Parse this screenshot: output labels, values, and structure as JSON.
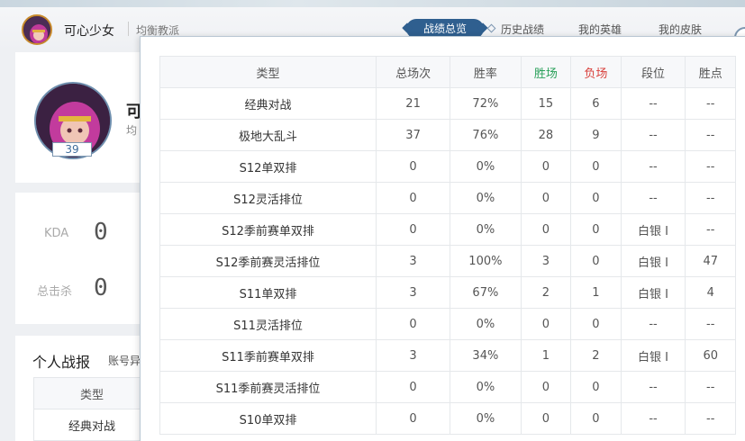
{
  "header": {
    "player_name": "可心少女",
    "school": "均衡教派",
    "tabs": [
      "战绩总览",
      "历史战绩",
      "我的英雄",
      "我的皮肤"
    ],
    "active_tab": "战绩总览"
  },
  "profile": {
    "name_peek": "可",
    "school_peek": "均",
    "level": "39"
  },
  "kda": {
    "kda_label": "KDA",
    "kda_value": "0",
    "kills_label": "总击杀",
    "kills_value": "0"
  },
  "personal_stats": {
    "title": "个人战报",
    "subtitle": "账号异",
    "mini_table": [
      [
        "类型"
      ],
      [
        "经典对战"
      ]
    ]
  },
  "modal": {
    "columns": [
      "类型",
      "总场次",
      "胜率",
      "胜场",
      "负场",
      "段位",
      "胜点"
    ],
    "colors": {
      "win": "#2aa05a",
      "lose": "#d9403c"
    },
    "rows": [
      [
        "经典对战",
        "21",
        "72%",
        "15",
        "6",
        "--",
        "--"
      ],
      [
        "极地大乱斗",
        "37",
        "76%",
        "28",
        "9",
        "--",
        "--"
      ],
      [
        "S12单双排",
        "0",
        "0%",
        "0",
        "0",
        "--",
        "--"
      ],
      [
        "S12灵活排位",
        "0",
        "0%",
        "0",
        "0",
        "--",
        "--"
      ],
      [
        "S12季前赛单双排",
        "0",
        "0%",
        "0",
        "0",
        "白银 Ⅰ",
        "--"
      ],
      [
        "S12季前赛灵活排位",
        "3",
        "100%",
        "3",
        "0",
        "白银 Ⅰ",
        "47"
      ],
      [
        "S11单双排",
        "3",
        "67%",
        "2",
        "1",
        "白银 Ⅰ",
        "4"
      ],
      [
        "S11灵活排位",
        "0",
        "0%",
        "0",
        "0",
        "--",
        "--"
      ],
      [
        "S11季前赛单双排",
        "3",
        "34%",
        "1",
        "2",
        "白银 Ⅰ",
        "60"
      ],
      [
        "S11季前赛灵活排位",
        "0",
        "0%",
        "0",
        "0",
        "--",
        "--"
      ],
      [
        "S10单双排",
        "0",
        "0%",
        "0",
        "0",
        "--",
        "--"
      ]
    ]
  }
}
